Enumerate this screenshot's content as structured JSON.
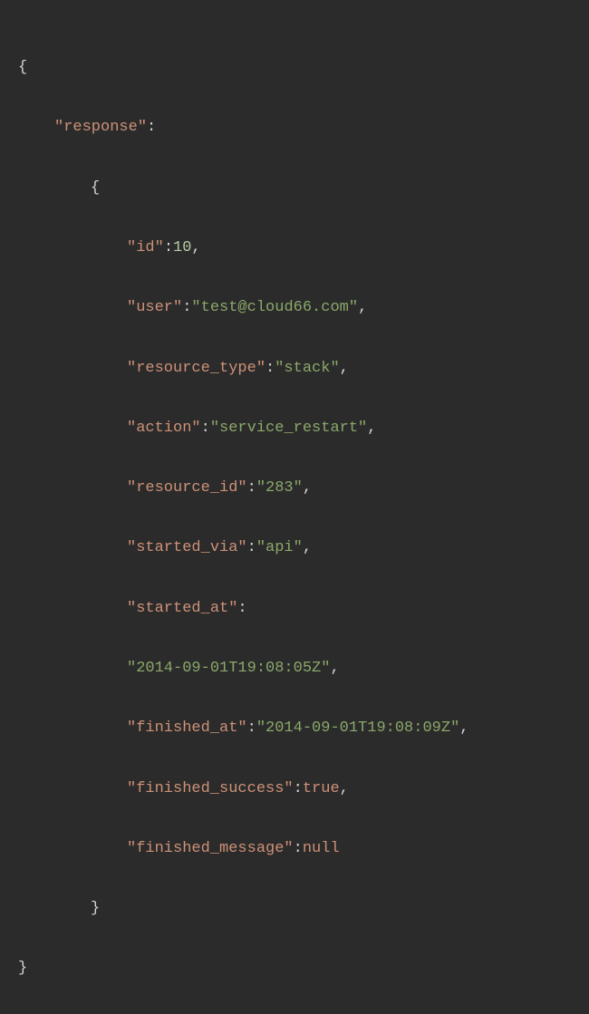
{
  "json": {
    "root_key": "\"response\"",
    "fields": {
      "id_key": "\"id\"",
      "id_val": "10",
      "user_key": "\"user\"",
      "user_val": "\"test@cloud66.com\"",
      "resource_type_key": "\"resource_type\"",
      "resource_type_val": "\"stack\"",
      "action_key": "\"action\"",
      "action_val": "\"service_restart\"",
      "resource_id_key": "\"resource_id\"",
      "resource_id_val": "\"283\"",
      "started_via_key": "\"started_via\"",
      "started_via_val": "\"api\"",
      "started_at_key": "\"started_at\"",
      "started_at_val": "\"2014-09-01T19:08:05Z\"",
      "finished_at_key": "\"finished_at\"",
      "finished_at_val": "\"2014-09-01T19:08:09Z\"",
      "finished_success_key": "\"finished_success\"",
      "finished_success_val": "true",
      "finished_message_key": "\"finished_message\"",
      "finished_message_val": "null"
    },
    "punct": {
      "open_brace": "{",
      "close_brace": "}",
      "colon": ":",
      "comma": ","
    }
  }
}
